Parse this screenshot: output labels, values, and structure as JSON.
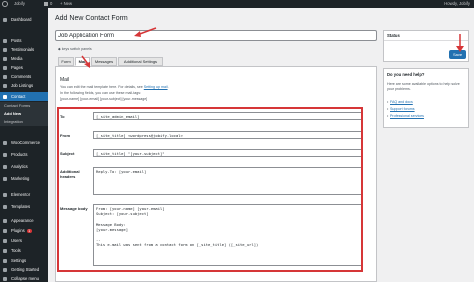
{
  "admin_bar": {
    "site_name": "Jobify",
    "comments_count": "0",
    "new_label": "New",
    "howdy": "Howdy, Jobify"
  },
  "sidebar": {
    "items": [
      {
        "label": "Dashboard"
      },
      {
        "label": "Posts"
      },
      {
        "label": "Testimonials"
      },
      {
        "label": "Media"
      },
      {
        "label": "Pages"
      },
      {
        "label": "Comments"
      },
      {
        "label": "Job Listings"
      },
      {
        "label": "Contact"
      }
    ],
    "submenu": [
      "Contact Forms",
      "Add New",
      "Integration"
    ],
    "items_bottom": [
      {
        "label": "WooCommerce"
      },
      {
        "label": "Products"
      },
      {
        "label": "Analytics"
      },
      {
        "label": "Marketing"
      },
      {
        "label": "Elementor"
      },
      {
        "label": "Templates"
      },
      {
        "label": "Appearance"
      },
      {
        "label": "Plugins",
        "badge": "1"
      },
      {
        "label": "Users"
      },
      {
        "label": "Tools"
      },
      {
        "label": "Settings"
      },
      {
        "label": "Getting Started"
      },
      {
        "label": "Collapse menu"
      }
    ]
  },
  "page": {
    "title": "Add New Contact Form",
    "form_title_value": "Job Application Form",
    "keyboard_hint": "◆ keys switch panels",
    "tabs": [
      "Form",
      "Mail",
      "Messages",
      "Additional Settings"
    ]
  },
  "mail": {
    "heading": "Mail",
    "hint1_pre": "You can edit the mail template here. For details, see ",
    "hint1_link": "Setting up mail",
    "hint1_post": ".",
    "hint2": "In the following fields, you can use these mail-tags:",
    "hint3": "[your-name] [your-email] [your-subject] [your-message]",
    "fields": {
      "to_label": "To",
      "to_value": "[_site_admin_email]",
      "from_label": "From",
      "from_value": "[_site_title] <wordpress@jobify.local>",
      "subject_label": "Subject",
      "subject_value": "[_site_title] \"[your-subject]\"",
      "headers_label": "Additional headers",
      "headers_value": "Reply-To: [your-email]",
      "body_label": "Message body",
      "body_value": "From: [your-name] [your-email]\nSubject: [your-subject]\n\nMessage Body:\n[your-message]\n\n--\nThis e-mail was sent from a contact form on [_site_title] ([_site_url])"
    }
  },
  "status_box": {
    "heading": "Status",
    "save_label": "Save"
  },
  "help_box": {
    "heading": "Do you need help?",
    "text": "Here are some available options to help solve your problems.",
    "links": [
      "FAQ and docs",
      "Support forums",
      "Professional services"
    ]
  },
  "colors": {
    "accent": "#2271b1",
    "sidebar": "#1d2327",
    "annotation": "#d63638"
  }
}
